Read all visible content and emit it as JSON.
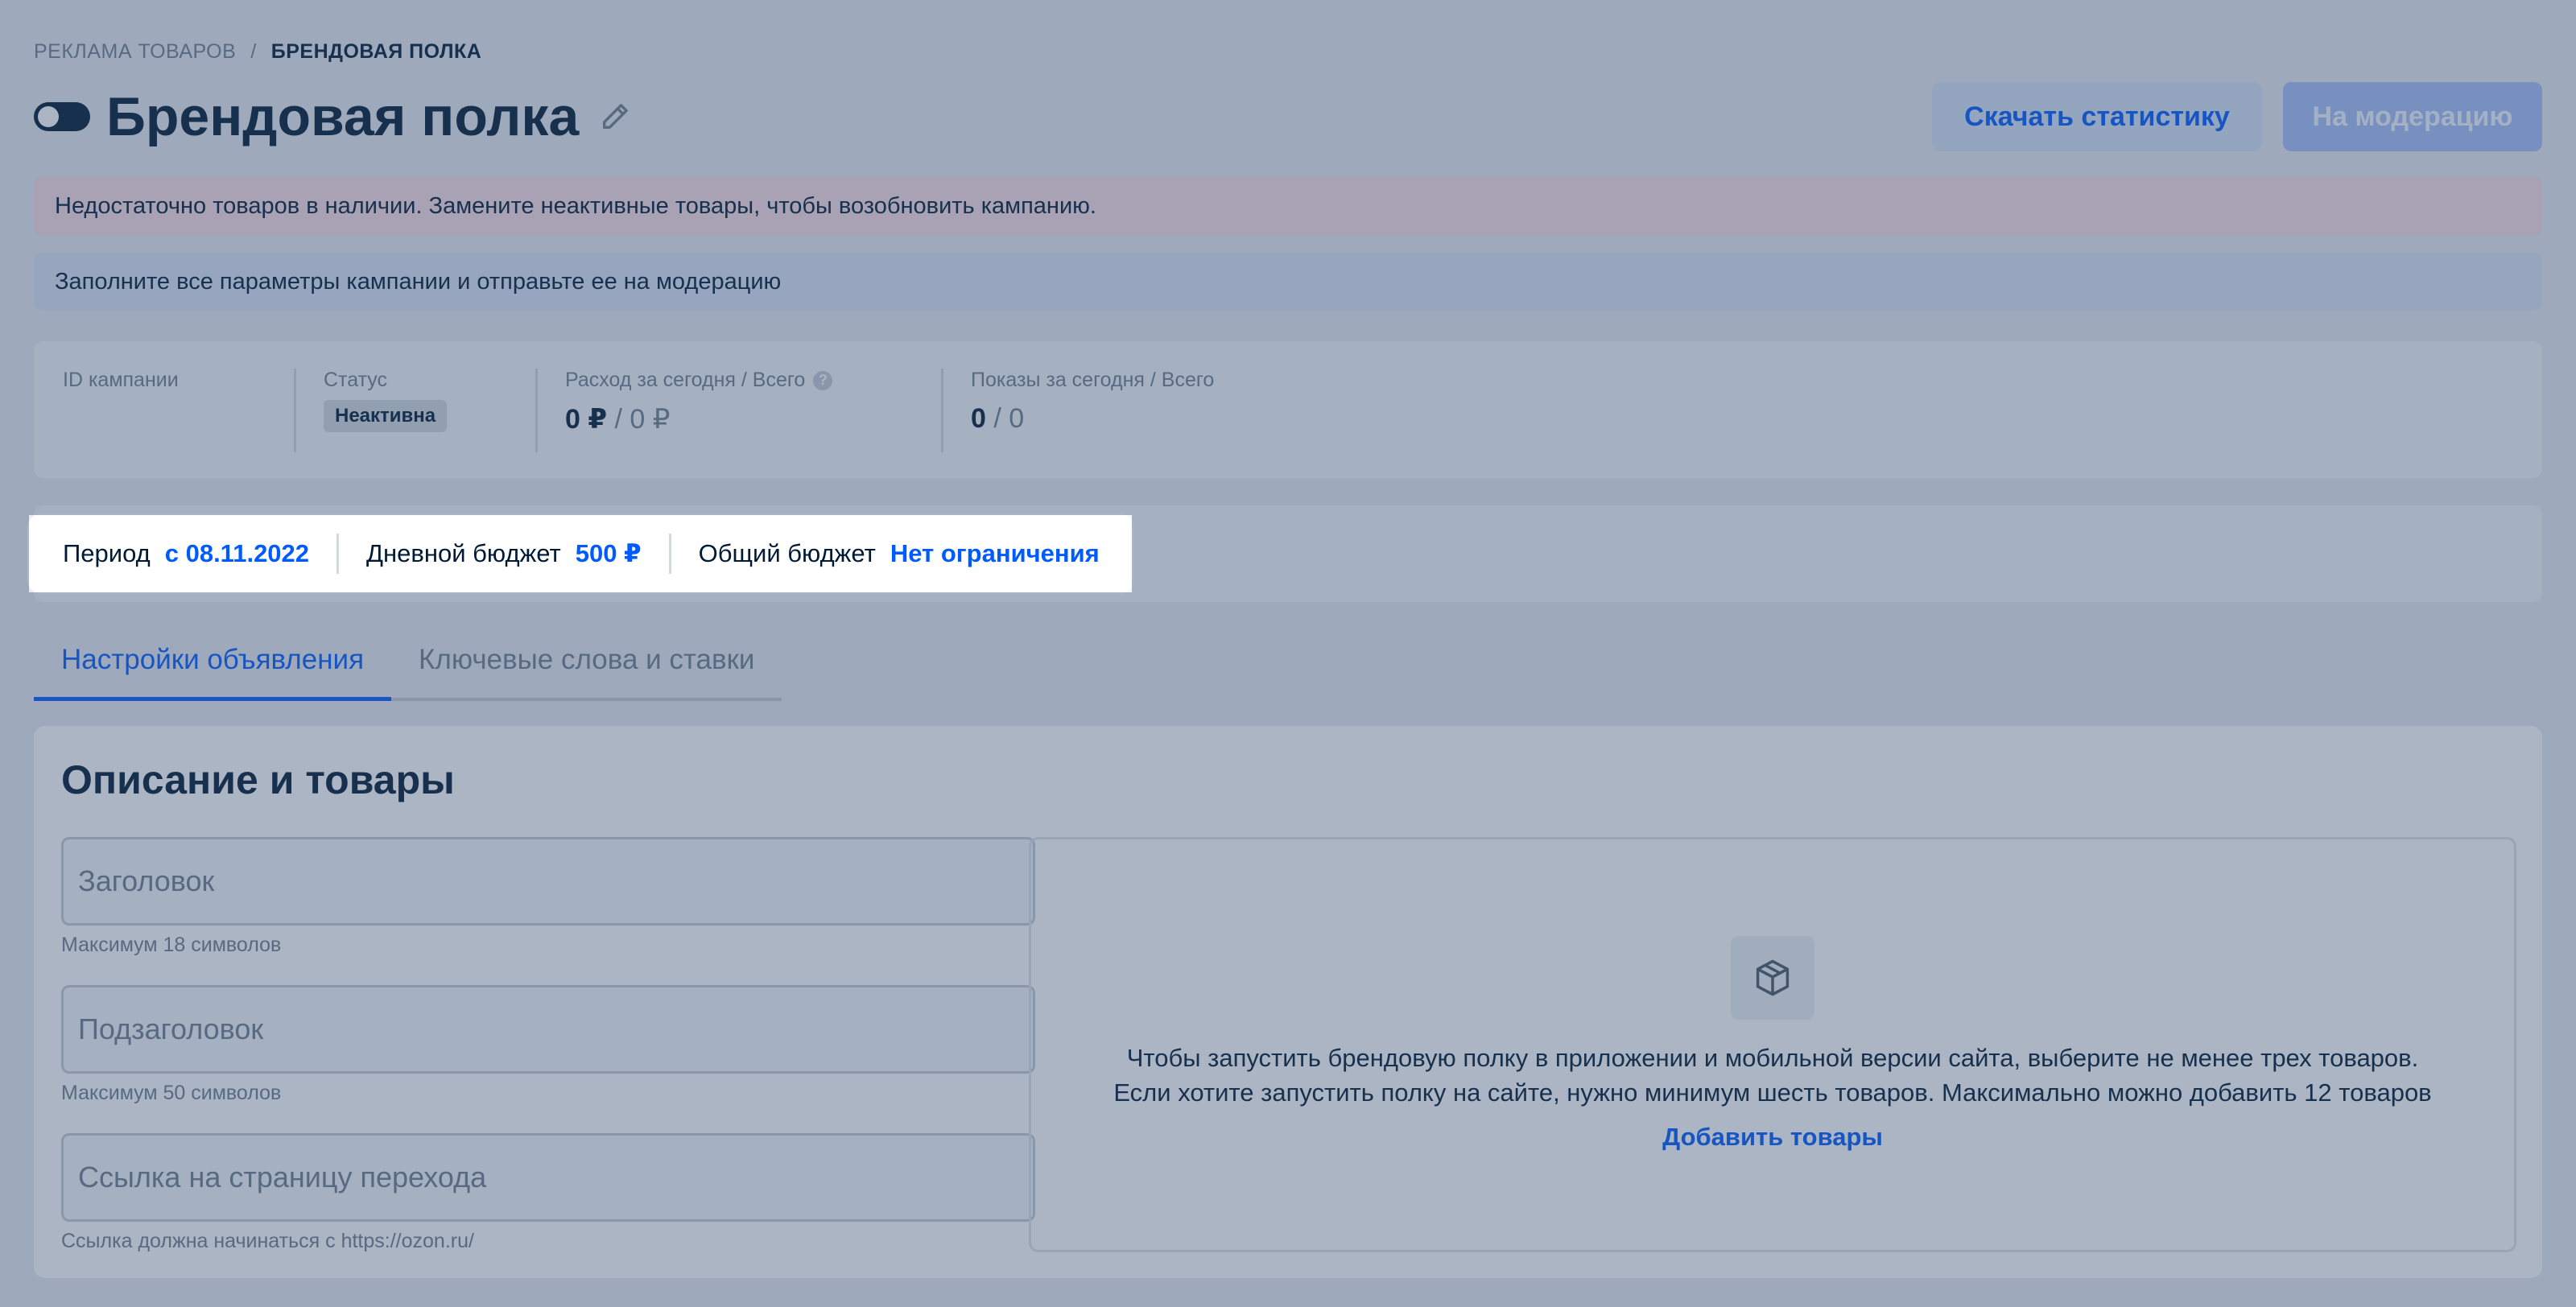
{
  "breadcrumb": {
    "parent": "РЕКЛАМА ТОВАРОВ",
    "separator": "/",
    "current": "БРЕНДОВАЯ ПОЛКА"
  },
  "header": {
    "title": "Брендовая полка",
    "download_label": "Скачать статистику",
    "moderation_label": "На модерацию"
  },
  "alerts": {
    "error": "Недостаточно товаров в наличии. Замените неактивные товары, чтобы возобновить кампанию.",
    "info": "Заполните все параметры кампании и отправьте ее на модерацию"
  },
  "stats": {
    "id_label": "ID кампании",
    "status_label": "Статус",
    "status_value": "Неактивна",
    "spend_label": "Расход за сегодня / Всего",
    "spend_today": "0 ₽",
    "spend_sep": "/",
    "spend_total": "0 ₽",
    "views_label": "Показы за сегодня / Всего",
    "views_today": "0",
    "views_sep": "/",
    "views_total": "0"
  },
  "budget": {
    "period_label": "Период",
    "period_value": "с 08.11.2022",
    "daily_label": "Дневной бюджет",
    "daily_value": "500 ₽",
    "total_label": "Общий бюджет",
    "total_value": "Нет ограничения"
  },
  "tabs": [
    {
      "label": "Настройки объявления",
      "active": true
    },
    {
      "label": "Ключевые слова и ставки",
      "active": false
    }
  ],
  "description": {
    "title": "Описание и товары",
    "heading_placeholder": "Заголовок",
    "heading_hint": "Максимум 18 символов",
    "subheading_placeholder": "Подзаголовок",
    "subheading_hint": "Максимум 50 символов",
    "link_placeholder": "Ссылка на страницу перехода",
    "link_hint": "Ссылка должна начинаться с https://ozon.ru/",
    "products_line1": "Чтобы запустить брендовую полку в приложении и мобильной версии сайта, выберите не менее трех товаров.",
    "products_line2": "Если хотите запустить полку на сайте, нужно минимум шесть товаров. Максимально можно добавить 12 товаров",
    "add_products_label": "Добавить товары"
  },
  "colors": {
    "accent": "#005bff",
    "text": "#001a34",
    "muted": "#707f8d",
    "error_bg": "#fbdde5",
    "info_bg": "#dde6f6"
  },
  "icons": {
    "edit": "pencil-icon",
    "help": "question-circle-icon",
    "products": "box-icon"
  }
}
